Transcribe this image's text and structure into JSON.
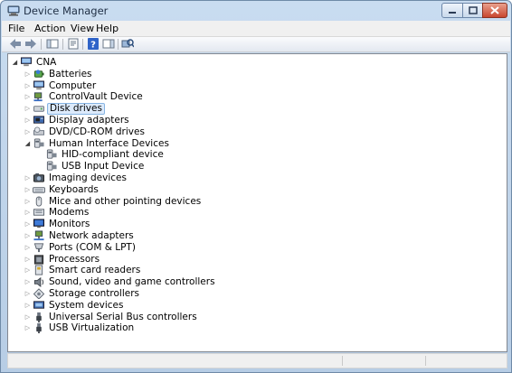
{
  "window": {
    "title": "Device Manager",
    "title_icon": "device-manager-icon"
  },
  "menu": [
    "File",
    "Action",
    "View",
    "Help"
  ],
  "toolbar": [
    {
      "name": "back-icon"
    },
    {
      "name": "forward-icon"
    },
    {
      "name": "show-hide-console-tree-icon"
    },
    {
      "name": "properties-icon"
    },
    {
      "name": "help-icon"
    },
    {
      "name": "show-hide-action-pane-icon"
    },
    {
      "name": "scan-hardware-changes-icon"
    }
  ],
  "tree": {
    "root": {
      "label": "CNA",
      "icon": "computer-icon",
      "expanded": true
    },
    "nodes": [
      {
        "label": "Batteries",
        "icon": "battery-icon",
        "expanded": false
      },
      {
        "label": "Computer",
        "icon": "computer-icon",
        "expanded": false
      },
      {
        "label": "ControlVault Device",
        "icon": "network-device-icon",
        "expanded": false
      },
      {
        "label": "Disk drives",
        "icon": "disk-drive-icon",
        "expanded": false,
        "selected": true
      },
      {
        "label": "Display adapters",
        "icon": "display-adapter-icon",
        "expanded": false
      },
      {
        "label": "DVD/CD-ROM drives",
        "icon": "dvd-drive-icon",
        "expanded": false
      },
      {
        "label": "Human Interface Devices",
        "icon": "hid-icon",
        "expanded": true,
        "children": [
          {
            "label": "HID-compliant device",
            "icon": "hid-icon"
          },
          {
            "label": "USB Input Device",
            "icon": "hid-icon"
          }
        ]
      },
      {
        "label": "Imaging devices",
        "icon": "camera-icon",
        "expanded": false
      },
      {
        "label": "Keyboards",
        "icon": "keyboard-icon",
        "expanded": false
      },
      {
        "label": "Mice and other pointing devices",
        "icon": "mouse-icon",
        "expanded": false
      },
      {
        "label": "Modems",
        "icon": "modem-icon",
        "expanded": false
      },
      {
        "label": "Monitors",
        "icon": "monitor-icon",
        "expanded": false
      },
      {
        "label": "Network adapters",
        "icon": "network-adapter-icon",
        "expanded": false
      },
      {
        "label": "Ports (COM & LPT)",
        "icon": "port-icon",
        "expanded": false
      },
      {
        "label": "Processors",
        "icon": "processor-icon",
        "expanded": false
      },
      {
        "label": "Smart card readers",
        "icon": "smart-card-reader-icon",
        "expanded": false
      },
      {
        "label": "Sound, video and game controllers",
        "icon": "speaker-icon",
        "expanded": false
      },
      {
        "label": "Storage controllers",
        "icon": "storage-controller-icon",
        "expanded": false
      },
      {
        "label": "System devices",
        "icon": "system-device-icon",
        "expanded": false
      },
      {
        "label": "Universal Serial Bus controllers",
        "icon": "usb-icon",
        "expanded": false
      },
      {
        "label": "USB Virtualization",
        "icon": "usb-icon",
        "expanded": false
      }
    ]
  },
  "colors": {
    "selection_fill": "#dceafb",
    "selection_border": "#86b4e3",
    "close_button": "#c8462f",
    "title_bar": "#c9dcf0"
  }
}
